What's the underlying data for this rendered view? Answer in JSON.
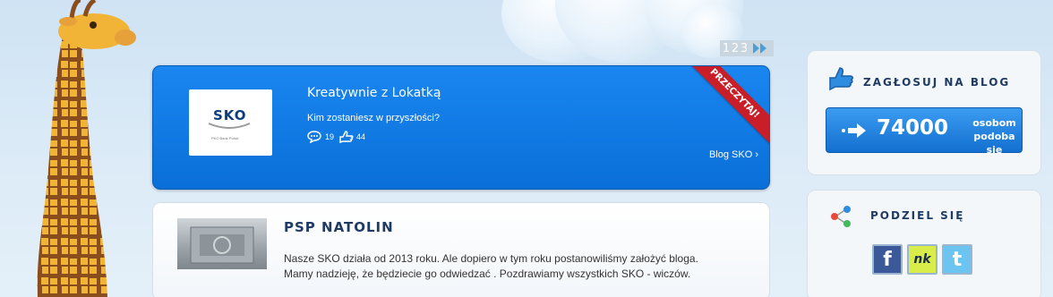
{
  "pager": {
    "pages": [
      "1",
      "2",
      "3"
    ]
  },
  "featured": {
    "logo_text": "SKO",
    "logo_bank": "PKO Bank Polski",
    "title": "Kreatywnie z Lokatką",
    "subtitle": "Kim zostaniesz w przyszłości?",
    "comments": "19",
    "likes": "44",
    "link": "Blog SKO ›",
    "ribbon": "PRZECZYTAJ!"
  },
  "post": {
    "title": "PSP NATOLIN",
    "text_line1": "Nasze SKO działa od 2013 roku. Ale dopiero w tym roku postanowiliśmy założyć bloga.",
    "text_line2": "Mamy nadzieję, że będziecie go odwiedzać . Pozdrawiamy wszystkich SKO - wiczów."
  },
  "vote": {
    "title": "ZAGŁOSUJ NA BLOG",
    "count": "74000",
    "label_line1": "osobom",
    "label_line2": "podoba się"
  },
  "share": {
    "title": "PODZIEL SIĘ",
    "facebook": "f",
    "nk": "nk",
    "twitter": "t"
  },
  "colors": {
    "accent_blue": "#0a6fd8",
    "ribbon_red": "#c81e2a",
    "title_navy": "#1f3b63"
  },
  "icons": [
    "giraffe-illustration",
    "comment-icon",
    "thumbs-up-icon",
    "arrow-right-icon",
    "share-icon",
    "facebook-icon",
    "nk-icon",
    "twitter-icon",
    "chevron-right-icon"
  ]
}
